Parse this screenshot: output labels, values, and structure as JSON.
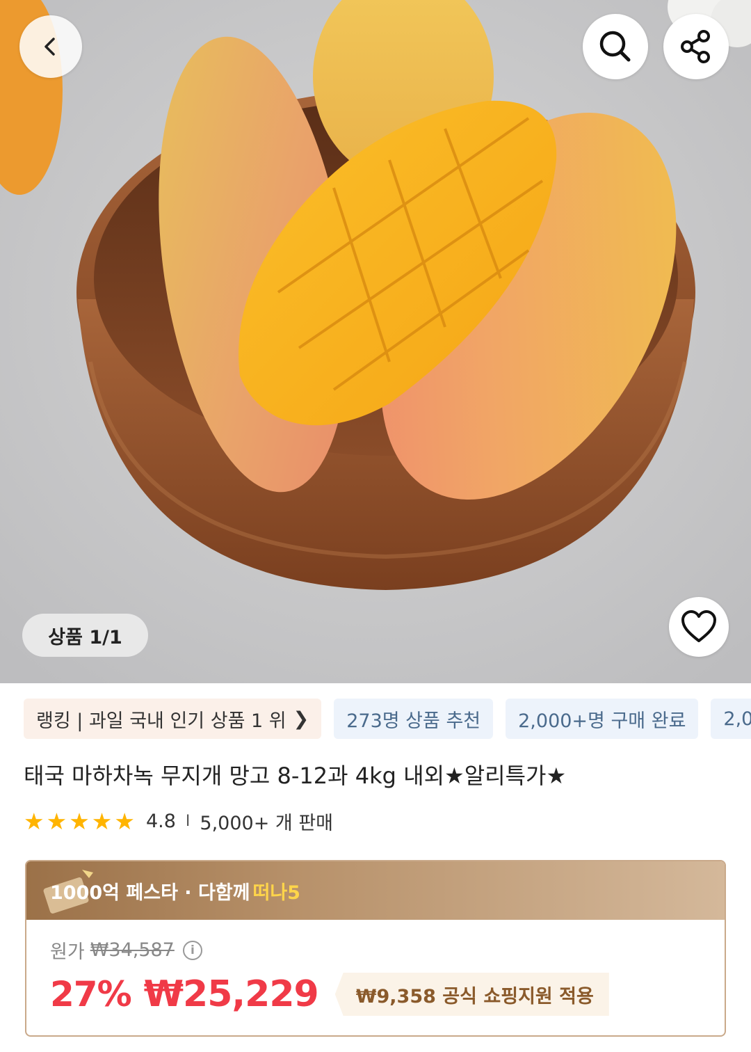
{
  "gallery": {
    "counter": "상품 1/1"
  },
  "chips": [
    {
      "label": "랭킹 | 과일 국내 인기 상품 1 위",
      "chevron": "❯"
    },
    {
      "label": "273명 상품 추천"
    },
    {
      "label": "2,000+명 구매 완료"
    },
    {
      "label": "2,0"
    }
  ],
  "product": {
    "title": "태국 마하차녹 무지개 망고 8-12과 4kg 내외★알리특가★",
    "rating": "4.8",
    "rating_stars": 5,
    "separator": "I",
    "sold": "5,000+ 개 판매"
  },
  "promo": {
    "banner_text": "1000억 페스타 · 다함께",
    "banner_accent": "떠나5",
    "original_label": "원가",
    "original_price": "₩34,587",
    "info_glyph": "i",
    "discount": "27%",
    "sale_price": "₩25,229",
    "coupon": "₩9,358 공식 쇼핑지원 적용"
  },
  "colors": {
    "accent_red": "#f03a47",
    "star_yellow": "#ffb400",
    "chip_blue_text": "#4a6a8c",
    "gold_banner": "#b8926b"
  },
  "icons": [
    "back-arrow-icon",
    "search-icon",
    "share-icon",
    "heart-icon",
    "star-icon",
    "info-icon",
    "ticket-icon"
  ]
}
